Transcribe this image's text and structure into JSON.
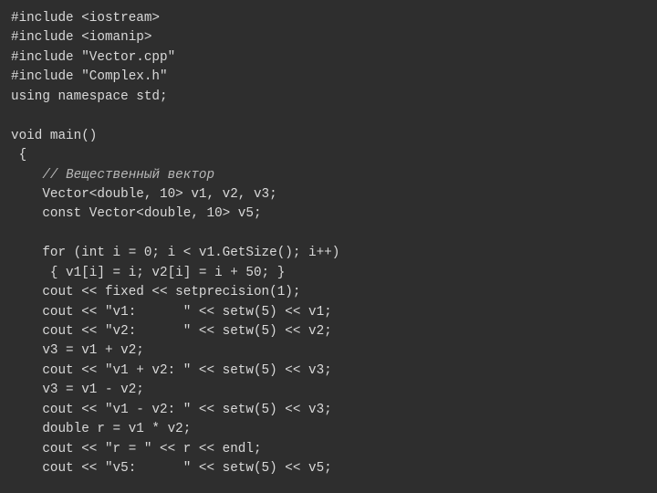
{
  "code": {
    "l01": "#include <iostream>",
    "l02": "#include <iomanip>",
    "l03": "#include \"Vector.cpp\"",
    "l04": "#include \"Complex.h\"",
    "l05": "using namespace std;",
    "l06": "",
    "l07": "void main()",
    "l08": " {",
    "l09a": "    ",
    "l09b": "// Вещественный вектор",
    "l10": "    Vector<double, 10> v1, v2, v3;",
    "l11": "    const Vector<double, 10> v5;",
    "l12": "",
    "l13": "    for (int i = 0; i < v1.GetSize(); i++)",
    "l14": "     { v1[i] = i; v2[i] = i + 50; }",
    "l15": "    cout << fixed << setprecision(1);",
    "l16": "    cout << \"v1:      \" << setw(5) << v1;",
    "l17": "    cout << \"v2:      \" << setw(5) << v2;",
    "l18": "    v3 = v1 + v2;",
    "l19": "    cout << \"v1 + v2: \" << setw(5) << v3;",
    "l20": "    v3 = v1 - v2;",
    "l21": "    cout << \"v1 - v2: \" << setw(5) << v3;",
    "l22": "    double r = v1 * v2;",
    "l23": "    cout << \"r = \" << r << endl;",
    "l24": "    cout << \"v5:      \" << setw(5) << v5;"
  }
}
